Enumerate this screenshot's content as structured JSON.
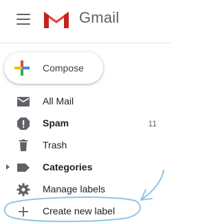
{
  "app": {
    "name": "Gmail"
  },
  "compose": {
    "label": "Compose"
  },
  "nav": [
    {
      "label": "All Mail",
      "icon": "all-mail-icon",
      "bold": false,
      "count": ""
    },
    {
      "label": "Spam",
      "icon": "spam-icon",
      "bold": true,
      "count": "11"
    },
    {
      "label": "Trash",
      "icon": "trash-icon",
      "bold": false,
      "count": ""
    },
    {
      "label": "Categories",
      "icon": "label-icon",
      "bold": true,
      "count": "",
      "collapsible": true
    },
    {
      "label": "Manage labels",
      "icon": "gear-icon",
      "bold": false,
      "count": ""
    },
    {
      "label": "Create new label",
      "icon": "plus-icon",
      "bold": false,
      "count": ""
    }
  ],
  "colors": {
    "gmail_red": "#ea4335",
    "annotation": "#8ec5e6",
    "icon_grey": "#5f6368"
  }
}
